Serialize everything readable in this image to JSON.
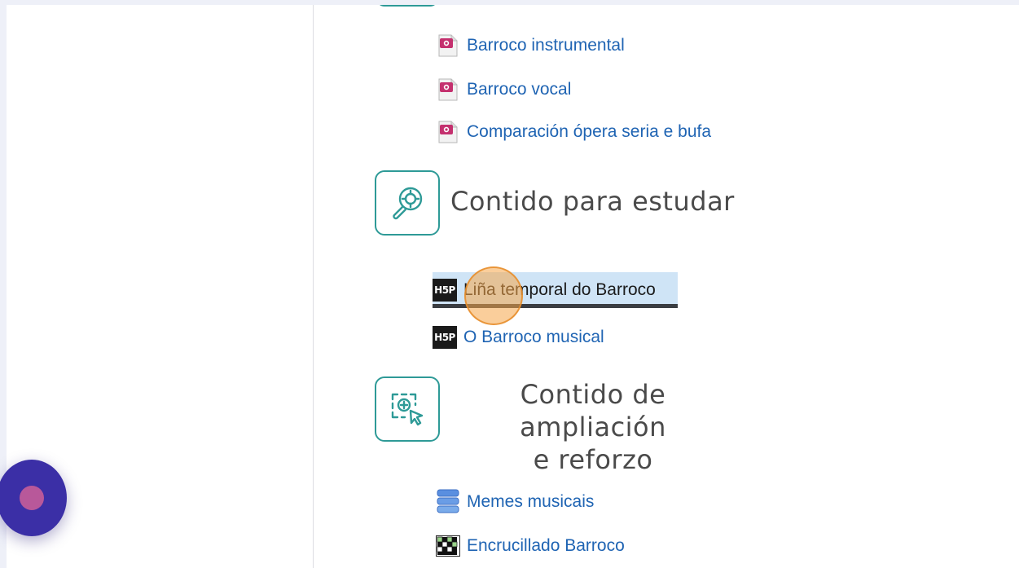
{
  "files": [
    {
      "label": "Barroco instrumental",
      "icon": "image-file-icon"
    },
    {
      "label": "Barroco vocal",
      "icon": "image-file-icon"
    },
    {
      "label": "Comparación ópera seria e bufa",
      "icon": "image-file-icon"
    }
  ],
  "section_study": {
    "title": "Contido para estudar",
    "icon": "magnifier-target-icon"
  },
  "h5p_items": [
    {
      "label": "Liña temporal do Barroco",
      "badge": "H5P",
      "highlighted": true
    },
    {
      "label": "O Barroco musical",
      "badge": "H5P",
      "highlighted": false
    }
  ],
  "section_extra": {
    "title_line1": "Contido de ampliación",
    "title_line2": "e reforzo",
    "icon": "zoom-select-cursor-icon"
  },
  "extra_items": [
    {
      "label": "Memes musicais",
      "icon": "database-icon"
    },
    {
      "label": "Encrucillado Barroco",
      "icon": "crossword-icon"
    }
  ],
  "colors": {
    "link": "#1f64b3",
    "accent_teal": "#2e9a97",
    "highlight": "#cfe4f6",
    "fab": "#3b2fa6"
  }
}
